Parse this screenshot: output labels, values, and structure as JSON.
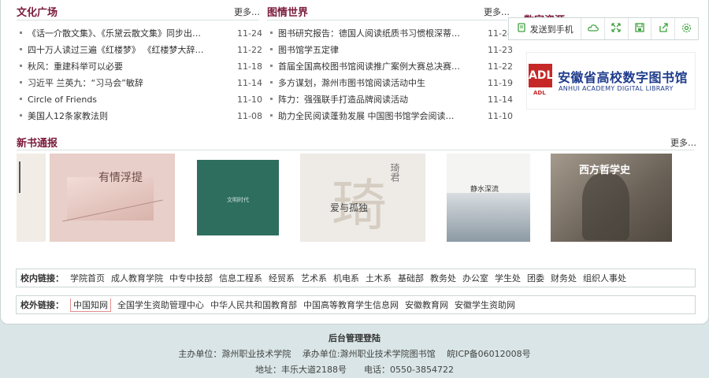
{
  "culture": {
    "title": "文化广场",
    "more": "更多…",
    "items": [
      {
        "text": "《话一介散文集》、《乐黛云散文集》同步出…",
        "date": "11-24"
      },
      {
        "text": "四十万人读过三遍《红楼梦》 《红楼梦大辞…",
        "date": "11-22"
      },
      {
        "text": "秋风：重建科举可以必要",
        "date": "11-18"
      },
      {
        "text": "习近平 兰英九：“习马会”敏辞",
        "date": "11-14"
      },
      {
        "text": "Circle of Friends",
        "date": "11-10"
      },
      {
        "text": "美国人12条家教法则",
        "date": "11-08"
      }
    ]
  },
  "library": {
    "title": "图情世界",
    "more": "更多…",
    "items": [
      {
        "text": "图书研究报告：德国人阅读纸质书习惯根深蒂…",
        "date": "11-24"
      },
      {
        "text": "图书馆学五定律",
        "date": "11-23"
      },
      {
        "text": "首届全国高校图书馆阅读推广案例大赛总决赛…",
        "date": "11-22"
      },
      {
        "text": "多方谋划，滁州市图书馆阅读活动中生",
        "date": "11-19"
      },
      {
        "text": "阵力：强强联手打造品牌阅读活动",
        "date": "11-14"
      },
      {
        "text": "助力全民阅读蓬勃发展 中国图书馆学会阅读…",
        "date": "11-10"
      }
    ]
  },
  "side": {
    "title": "数字资源",
    "send_label": "发送到手机",
    "logo": {
      "mark": "ADL",
      "cn": "安徽省高校数字图书馆",
      "en": "ANHUI ACADEMY DIGITAL LIBRARY",
      "sub": "ADL"
    }
  },
  "newbooks": {
    "title": "新书通报",
    "more": "更多…",
    "books": [
      {
        "title": "有情浮提"
      },
      {
        "title": "文明时代"
      },
      {
        "title": "爱与孤独",
        "author": "琦君"
      },
      {
        "title": "静水深流"
      },
      {
        "title": "西方哲学史"
      }
    ]
  },
  "internal_links": {
    "label": "校内链接：",
    "items": [
      "学院首页",
      "成人教育学院",
      "中专中技部",
      "信息工程系",
      "经贸系",
      "艺术系",
      "机电系",
      "土木系",
      "基础部",
      "教务处",
      "办公室",
      "学生处",
      "团委",
      "财务处",
      "组织人事处"
    ]
  },
  "external_links": {
    "label": "校外链接：",
    "items": [
      "中国知网",
      "全国学生资助管理中心",
      "中华人民共和国教育部",
      "中国高等教育学生信息网",
      "安徽教育网",
      "安徽学生资助网"
    ]
  },
  "footer": {
    "admin": "后台管理登陆",
    "line1": "主办单位：滁州职业技术学院　 承办单位:滁州职业技术学院图书馆　 皖ICP备06012008号",
    "line2": "地址：丰乐大道2188号　　电话：0550-3854722"
  },
  "colors": {
    "title": "#7a1a3a",
    "icon": "#3ea23e",
    "logo_red": "#c62828",
    "logo_blue": "#1f3c8c"
  }
}
